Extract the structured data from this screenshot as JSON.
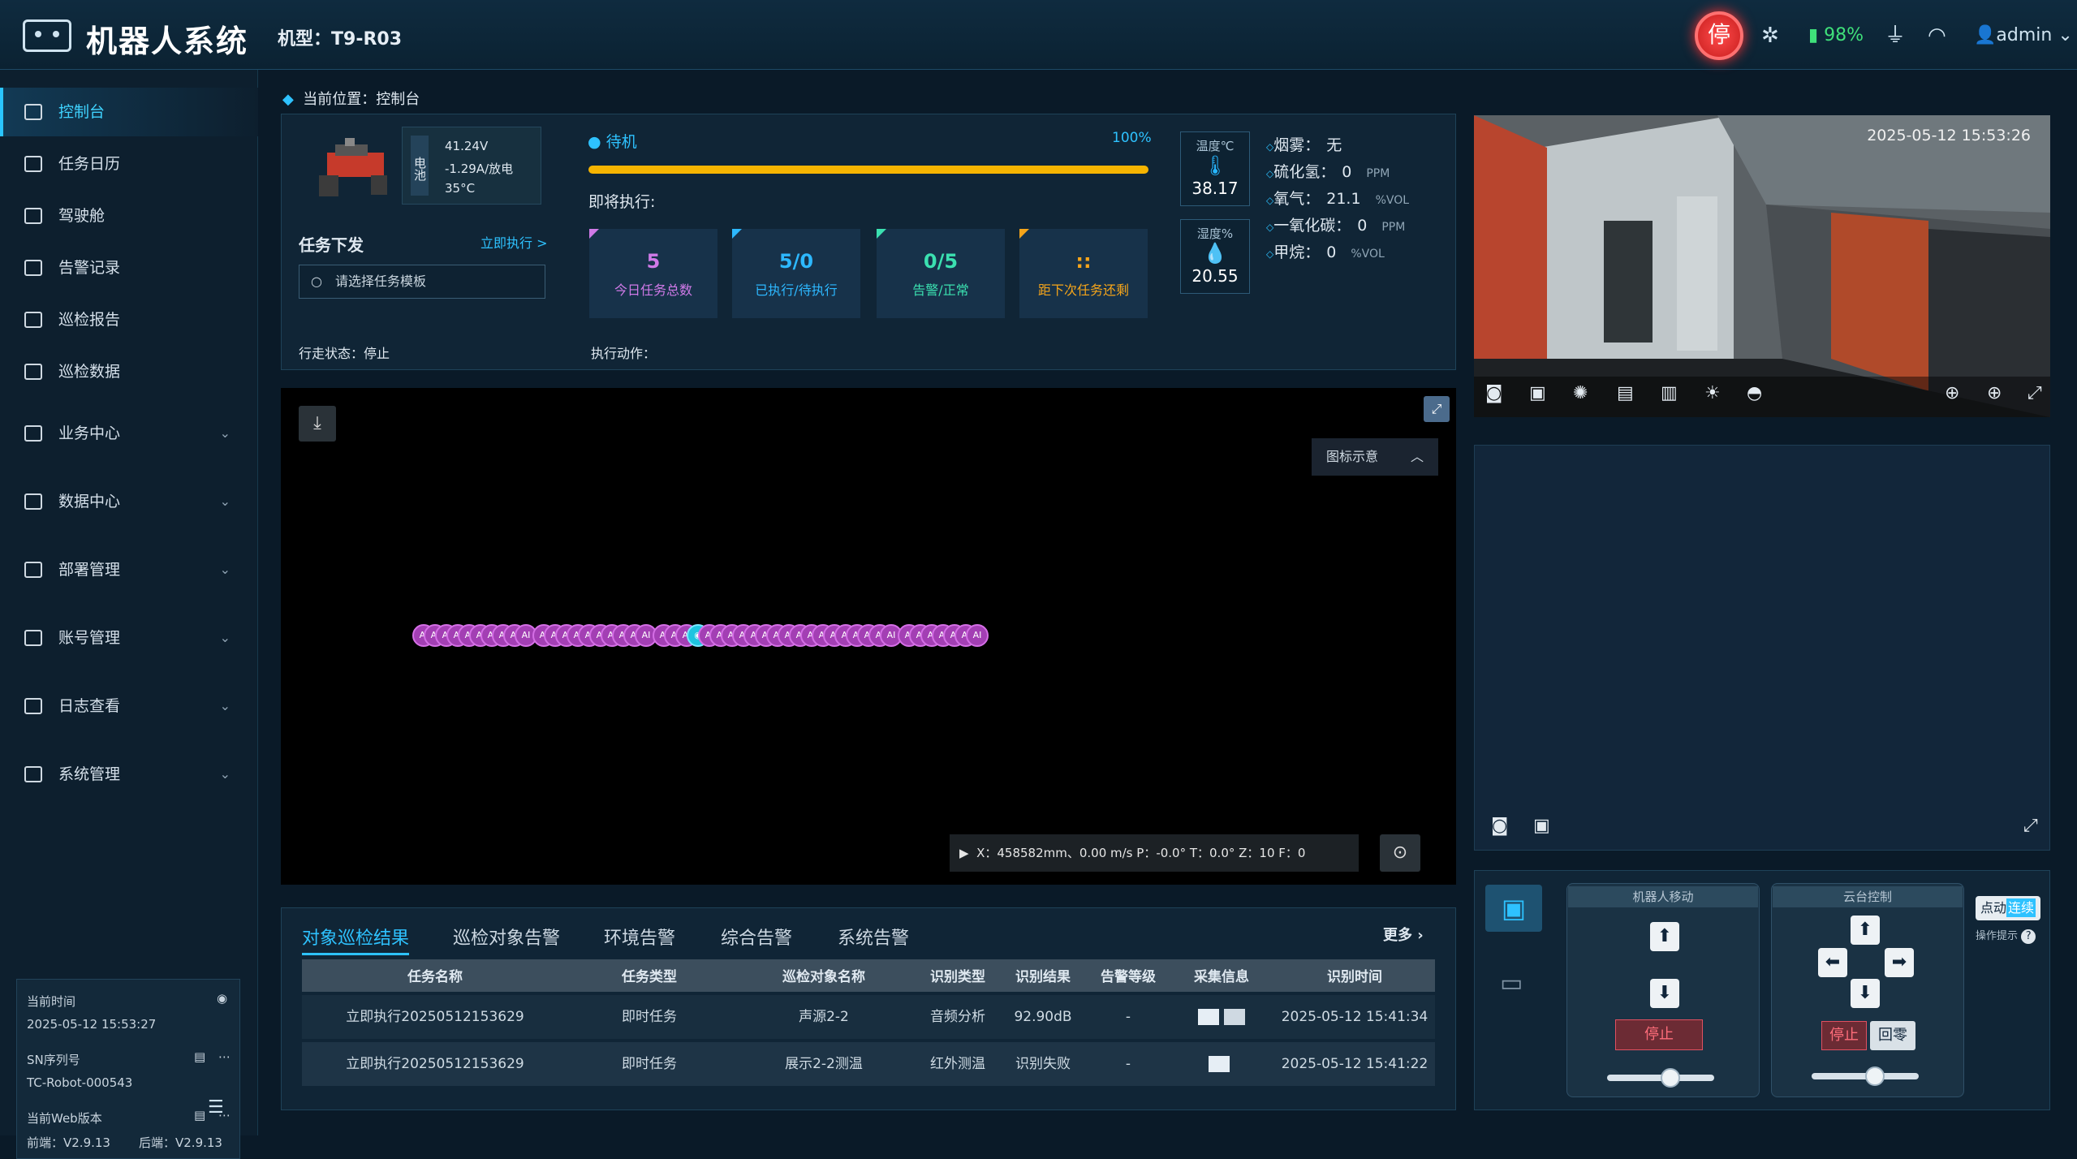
{
  "header": {
    "title": "机器人系统",
    "model_label": "机型：T9-R03",
    "stop_label": "停",
    "battery": "98%",
    "user": "admin"
  },
  "sidebar": {
    "items": [
      {
        "label": "控制台",
        "icon": "monitor-icon",
        "active": true
      },
      {
        "label": "任务日历",
        "icon": "calendar-icon"
      },
      {
        "label": "驾驶舱",
        "icon": "cockpit-icon"
      },
      {
        "label": "告警记录",
        "icon": "alarm-icon"
      },
      {
        "label": "巡检报告",
        "icon": "report-icon"
      },
      {
        "label": "巡检数据",
        "icon": "data-icon"
      },
      {
        "label": "业务中心",
        "icon": "folder-icon",
        "expandable": true
      },
      {
        "label": "数据中心",
        "icon": "database-icon",
        "expandable": true
      },
      {
        "label": "部署管理",
        "icon": "deploy-icon",
        "expandable": true
      },
      {
        "label": "账号管理",
        "icon": "account-icon",
        "expandable": true
      },
      {
        "label": "日志查看",
        "icon": "log-icon",
        "expandable": true
      },
      {
        "label": "系统管理",
        "icon": "settings-icon",
        "expandable": true
      }
    ],
    "info": {
      "time_label": "当前时间",
      "time": "2025-05-12 15:53:27",
      "sn_label": "SN序列号",
      "sn": "TC-Robot-000543",
      "ver_label": "当前Web版本",
      "front": "前端：V2.9.13",
      "back": "后端：V2.9.13"
    }
  },
  "breadcrumb": "当前位置：控制台",
  "robot": {
    "bat_label": "电池",
    "voltage": "41.24V",
    "current": "-1.29A/放电",
    "temp": "35°C"
  },
  "task": {
    "title": "任务下发",
    "exec_link": "立即执行 >",
    "placeholder": "请选择任务模板",
    "walk_state": "行走状态：停止",
    "exec_action": "执行动作："
  },
  "status": {
    "state": "待机",
    "percent": "100%",
    "next": "即将执行:",
    "progress": 1.0
  },
  "tiles": [
    {
      "num": "5",
      "label": "今日任务总数",
      "color": "#d07ae8"
    },
    {
      "num": "5/0",
      "label": "已执行/待执行",
      "color": "#2db8ff"
    },
    {
      "num": "0/5",
      "label": "告警/正常",
      "color": "#3be0b0"
    },
    {
      "num": "::",
      "label": "距下次任务还剩",
      "color": "#f6a51a"
    }
  ],
  "sensors": [
    {
      "head": "温度℃",
      "value": "38.17"
    },
    {
      "head": "湿度%",
      "value": "20.55"
    }
  ],
  "gases": [
    {
      "name": "烟雾：",
      "value": "无",
      "unit": ""
    },
    {
      "name": "硫化氢：",
      "value": "0",
      "unit": "PPM"
    },
    {
      "name": "氧气：",
      "value": "21.1",
      "unit": "%VOL"
    },
    {
      "name": "一氧化碳：",
      "value": "0",
      "unit": "PPM"
    },
    {
      "name": "甲烷：",
      "value": "0",
      "unit": "%VOL"
    }
  ],
  "map": {
    "legend": "图标示意",
    "coords": "X：458582mm、0.00 m/s   P：-0.0°   T：0.0°   Z：10   F：0",
    "dot_label": "AI"
  },
  "tabs": [
    "对象巡检结果",
    "巡检对象告警",
    "环境告警",
    "综合告警",
    "系统告警"
  ],
  "more": "更多 ›",
  "table": {
    "headers": [
      "任务名称",
      "任务类型",
      "巡检对象名称",
      "识别类型",
      "识别结果",
      "告警等级",
      "采集信息",
      "识别时间"
    ],
    "rows": [
      [
        "立即执行20250512153629",
        "即时任务",
        "声源2-2",
        "音频分析",
        "92.90dB",
        "-",
        "",
        "2025-05-12 15:41:34"
      ],
      [
        "立即执行20250512153629",
        "即时任务",
        "展示2-2测温",
        "红外测温",
        "识别失败",
        "-",
        "",
        "2025-05-12 15:41:22"
      ]
    ]
  },
  "camera": {
    "timestamp": "2025-05-12 15:53:26"
  },
  "control": {
    "move_title": "机器人移动",
    "ptz_title": "云台控制",
    "stop": "停止",
    "zero": "回零",
    "mode_a": "点动",
    "mode_b": "连续",
    "hint": "操作提示"
  }
}
